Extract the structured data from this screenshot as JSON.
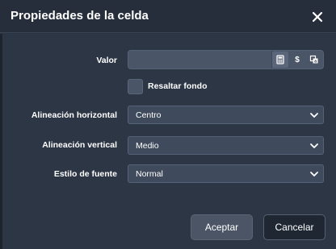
{
  "dialog": {
    "title": "Propiedades de la celda",
    "close_icon": "close-icon"
  },
  "fields": {
    "value": {
      "label": "Valor",
      "value": "",
      "placeholder": "",
      "addons": [
        {
          "name": "calculator-icon",
          "glyph": ""
        },
        {
          "name": "dollar-icon",
          "glyph": "$"
        },
        {
          "name": "copy-format-icon",
          "glyph": ""
        }
      ]
    },
    "highlight": {
      "label": "Resaltar fondo",
      "checked": false
    },
    "horizontal_alignment": {
      "label": "Alineación horizontal",
      "selected": "Centro"
    },
    "vertical_alignment": {
      "label": "Alineación vertical",
      "selected": "Medio"
    },
    "font_style": {
      "label": "Estilo de fuente",
      "selected": "Normal"
    }
  },
  "buttons": {
    "accept": "Aceptar",
    "cancel": "Cancelar"
  },
  "colors": {
    "background": "#2d3645",
    "header": "#262e3b",
    "input": "#4a5568",
    "accept_button": "#4b5566",
    "cancel_button": "#1f2733"
  }
}
